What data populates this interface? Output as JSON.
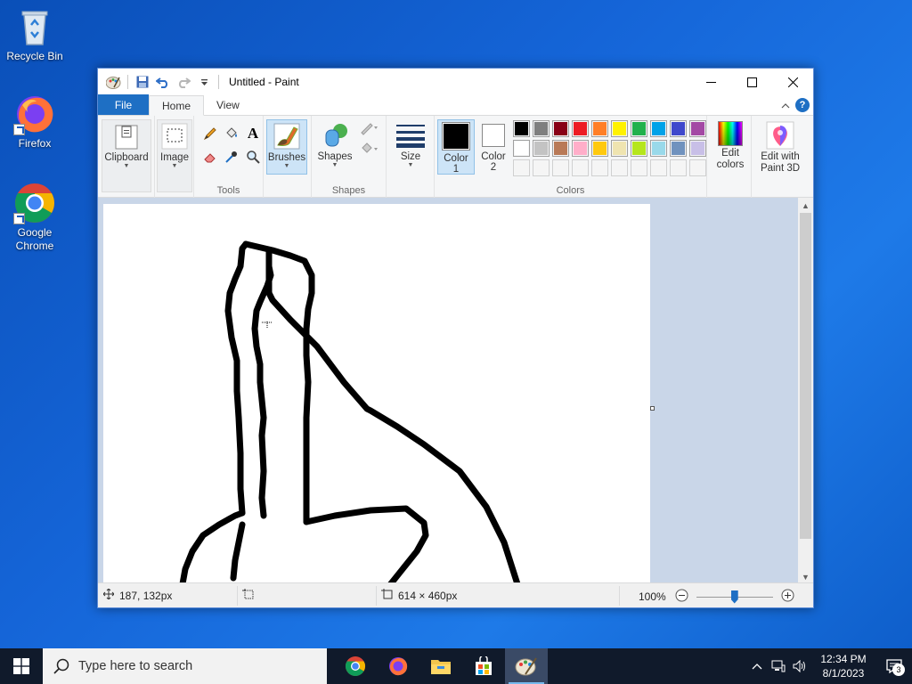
{
  "desktop": {
    "icons": [
      {
        "label": "Recycle Bin",
        "icon": "recycle-bin-icon"
      },
      {
        "label": "Firefox",
        "icon": "firefox-icon"
      },
      {
        "label": "Google Chrome",
        "icon": "chrome-icon"
      }
    ]
  },
  "window": {
    "title": "Untitled - Paint",
    "controls": {
      "minimize": "—",
      "maximize": "☐",
      "close": "✕"
    }
  },
  "tabs": [
    {
      "label": "File"
    },
    {
      "label": "Home"
    },
    {
      "label": "View"
    }
  ],
  "ribbon": {
    "clipboard": {
      "label": "Clipboard"
    },
    "image": {
      "label": "Image"
    },
    "tools": {
      "label": "Tools"
    },
    "brushes": {
      "label": "Brushes"
    },
    "shapes": {
      "button_label": "Shapes",
      "group_label": "Shapes"
    },
    "size": {
      "label": "Size"
    },
    "color1": {
      "label": "Color",
      "num": "1",
      "color": "#000000"
    },
    "color2": {
      "label": "Color",
      "num": "2",
      "color": "#ffffff"
    },
    "colors_group_label": "Colors",
    "edit_colors": {
      "line1": "Edit",
      "line2": "colors"
    },
    "edit_3d": {
      "line1": "Edit with",
      "line2": "Paint 3D"
    },
    "palette_row1": [
      "#000000",
      "#7f7f7f",
      "#880015",
      "#ed1c24",
      "#ff7f27",
      "#fff200",
      "#22b14c",
      "#00a2e8",
      "#3f48cc",
      "#a349a4"
    ],
    "palette_row2": [
      "#ffffff",
      "#c3c3c3",
      "#b97a57",
      "#ffaec9",
      "#ffc90e",
      "#efe4b0",
      "#b5e61d",
      "#99d9ea",
      "#7092be",
      "#c8bfe7"
    ],
    "palette_row3": [
      "#f5f5f5",
      "#f5f5f5",
      "#f5f5f5",
      "#f5f5f5",
      "#f5f5f5",
      "#f5f5f5",
      "#f5f5f5",
      "#f5f5f5",
      "#f5f5f5",
      "#f5f5f5"
    ]
  },
  "statusbar": {
    "cursor_pos": "187, 132px",
    "canvas_size": "614 × 460px",
    "zoom": "100%",
    "zoom_level": 0.5
  },
  "taskbar": {
    "search_placeholder": "Type here to search",
    "time": "12:34 PM",
    "date": "8/1/2023",
    "notification_count": "3"
  }
}
